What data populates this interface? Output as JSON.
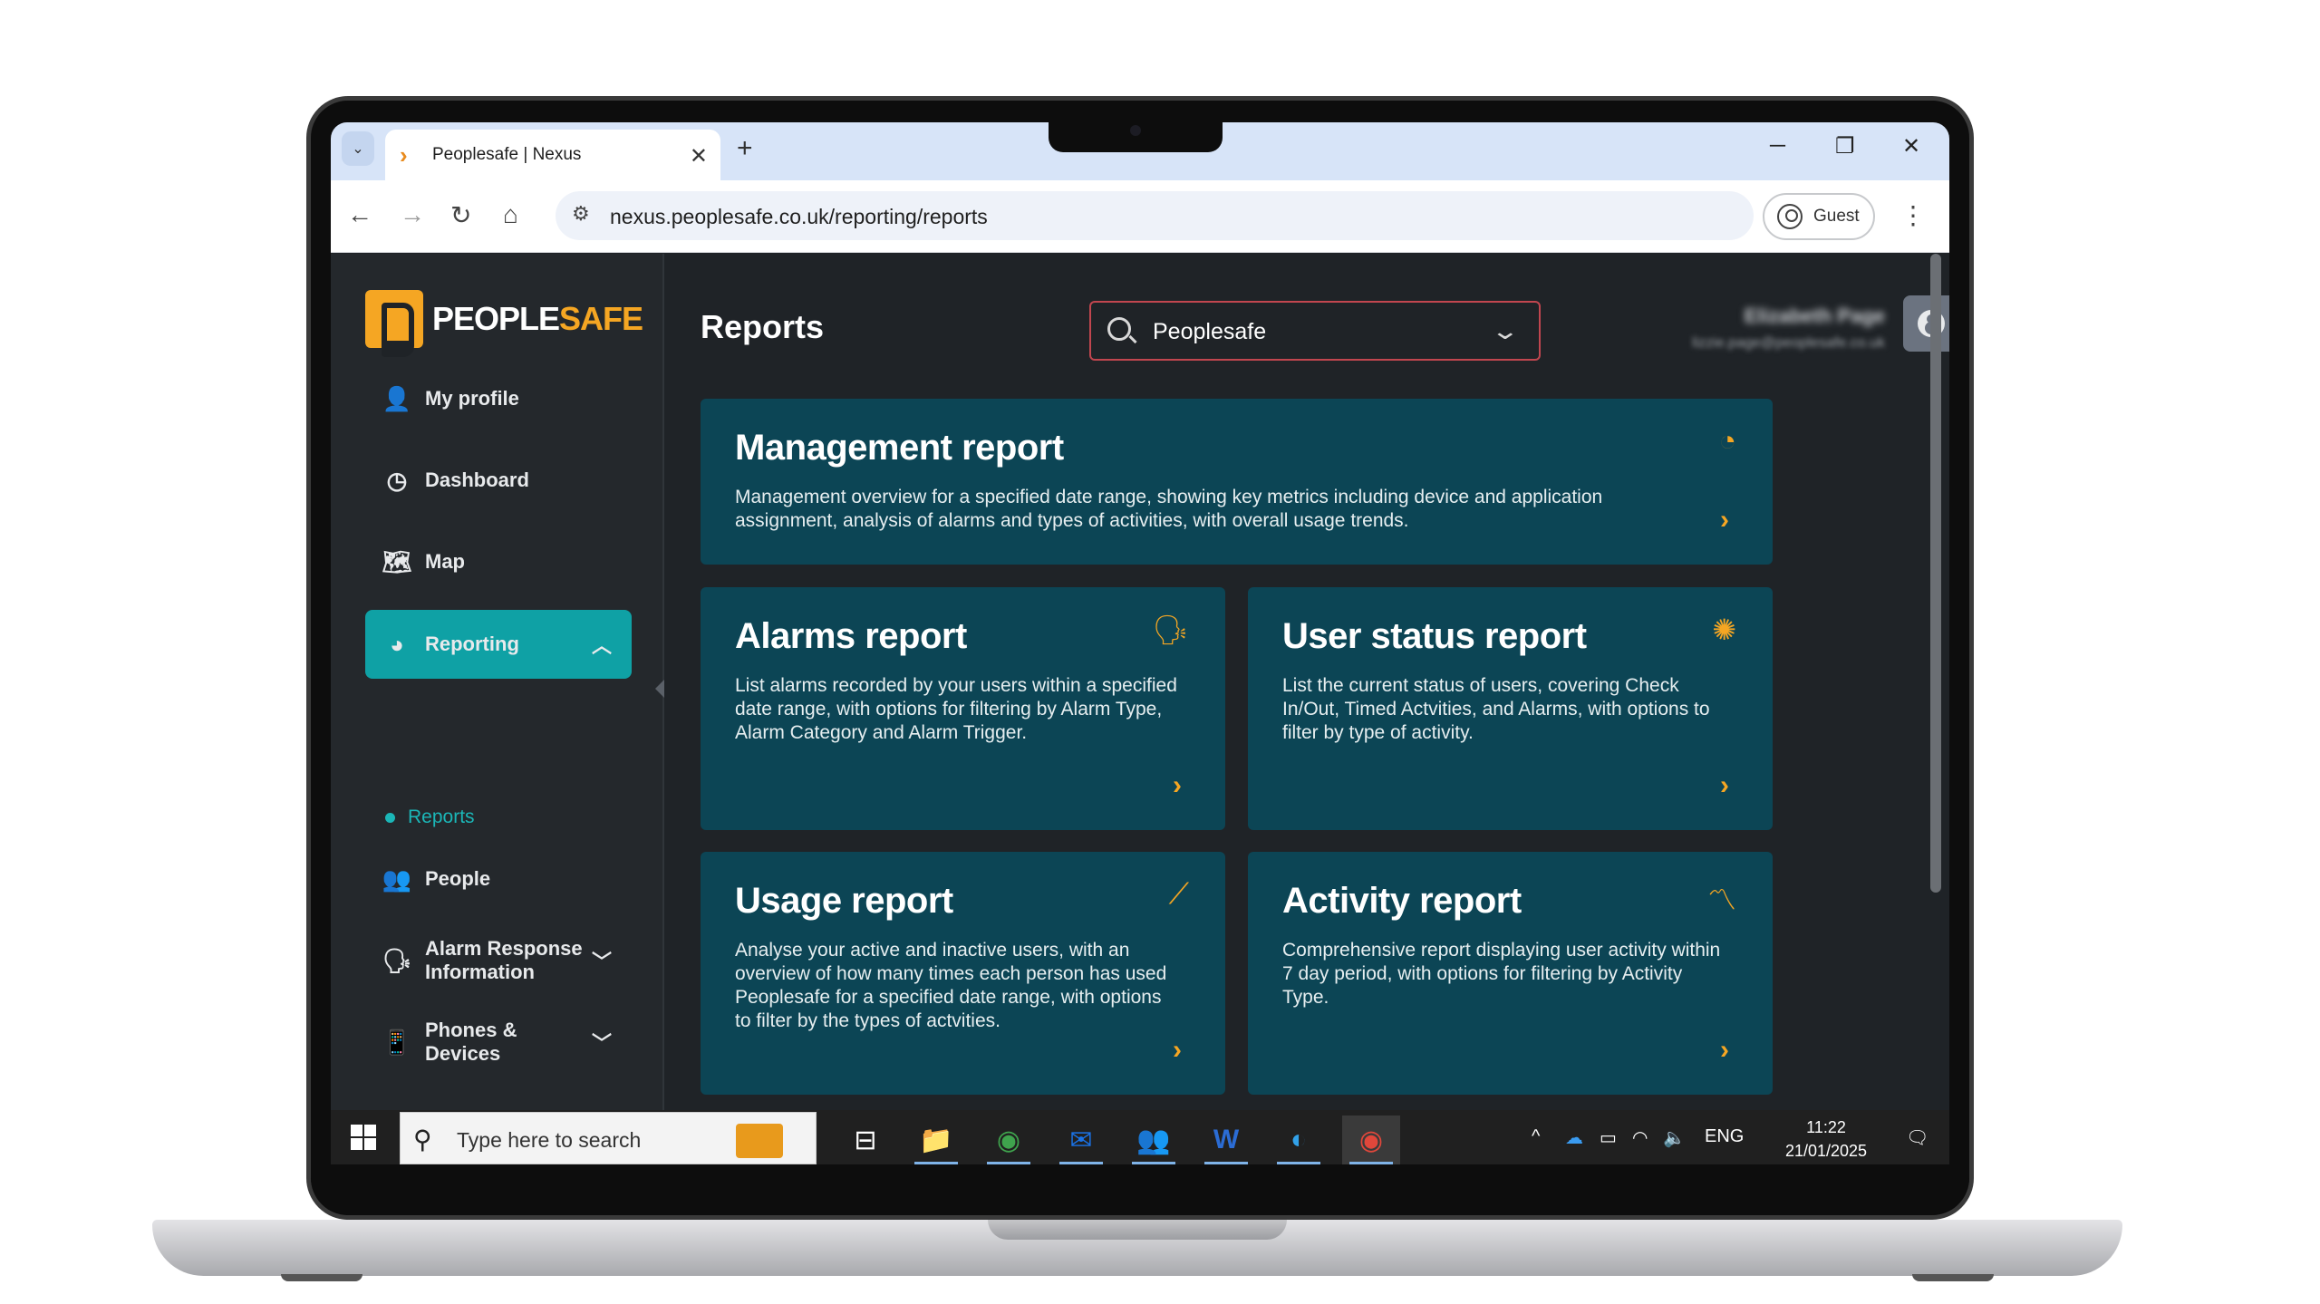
{
  "browser": {
    "tab_title": "Peoplesafe | Nexus",
    "tab_close": "✕",
    "new_tab": "+",
    "url": "nexus.peoplesafe.co.uk/reporting/reports",
    "profile_label": "Guest",
    "window_controls": {
      "minimize": "─",
      "restore": "❐",
      "close": "✕"
    },
    "nav": {
      "back": "←",
      "forward": "→",
      "reload": "↻",
      "home": "⌂",
      "menu": "⋮"
    }
  },
  "brand": {
    "part1": "PEOPLE",
    "part2": "SAFE",
    "accent": "#f5a623"
  },
  "sidebar": {
    "items": [
      {
        "label": "My profile",
        "icon": "user-icon",
        "glyph": "👤"
      },
      {
        "label": "Dashboard",
        "icon": "gauge-icon",
        "glyph": "◷"
      },
      {
        "label": "Map",
        "icon": "map-search-icon",
        "glyph": "🗺"
      },
      {
        "label": "Reporting",
        "icon": "pie-chart-icon",
        "glyph": "◕",
        "chevron": "︿"
      },
      {
        "label": "People",
        "icon": "people-icon",
        "glyph": "👥"
      },
      {
        "label": "Alarm Response Information",
        "icon": "alarm-user-icon",
        "glyph": "🗣",
        "chevron": "﹀"
      },
      {
        "label": "Phones & Devices",
        "icon": "device-icon",
        "glyph": "📱",
        "chevron": "﹀"
      }
    ],
    "sub_item": "Reports",
    "active_color": "#0fa1a5"
  },
  "header": {
    "title": "Reports",
    "org_select_value": "Peoplesafe",
    "user_name": "Elizabeth Page",
    "user_email": "lizzie.page@peoplesafe.co.uk"
  },
  "cards": [
    {
      "title": "Management report",
      "desc": "Management overview for a specified date range, showing key metrics including device and application assignment, analysis of alarms and types of activities, with overall usage trends.",
      "icon": "chart-circle-icon",
      "glyph": "◔",
      "arrow": "›"
    },
    {
      "title": "Alarms report",
      "desc": "List alarms recorded by your users within a specified date range, with options for filtering by Alarm Type, Alarm Category and Alarm Trigger.",
      "icon": "alarm-user-icon",
      "glyph": "🗣",
      "arrow": "›"
    },
    {
      "title": "User status report",
      "desc": "List the current status of users, covering Check In/Out, Timed Actvities, and Alarms, with options to filter by type of activity.",
      "icon": "status-spinner-icon",
      "glyph": "✺",
      "arrow": "›"
    },
    {
      "title": "Usage report",
      "desc": "Analyse your active and inactive users, with an overview of how many times each person has used Peoplesafe for a specified date range, with options to filter by the types of actvities.",
      "icon": "trend-sparkle-icon",
      "glyph": "⟋",
      "arrow": "›"
    },
    {
      "title": "Activity report",
      "desc": "Comprehensive report displaying user activity within 7 day period, with options for filtering by Activity Type.",
      "icon": "trend-line-icon",
      "glyph": "〽",
      "arrow": "›"
    }
  ],
  "taskbar": {
    "search_placeholder": "Type here to search",
    "apps": [
      {
        "name": "task-view-icon",
        "glyph": "⊟"
      },
      {
        "name": "file-explorer-icon",
        "glyph": "📁"
      },
      {
        "name": "chrome-icon",
        "glyph": "◉"
      },
      {
        "name": "outlook-icon",
        "glyph": "✉"
      },
      {
        "name": "teams-icon",
        "glyph": "👥"
      },
      {
        "name": "word-icon",
        "glyph": "W"
      },
      {
        "name": "edge-icon",
        "glyph": "◐"
      },
      {
        "name": "chrome-active-icon",
        "glyph": "◉"
      }
    ],
    "tray": {
      "chevron": "^",
      "onedrive": "☁",
      "battery": "▭",
      "wifi": "◠",
      "volume": "🔈",
      "lang": "ENG",
      "notifications": "🗨"
    },
    "time": "11:22",
    "date": "21/01/2025"
  }
}
